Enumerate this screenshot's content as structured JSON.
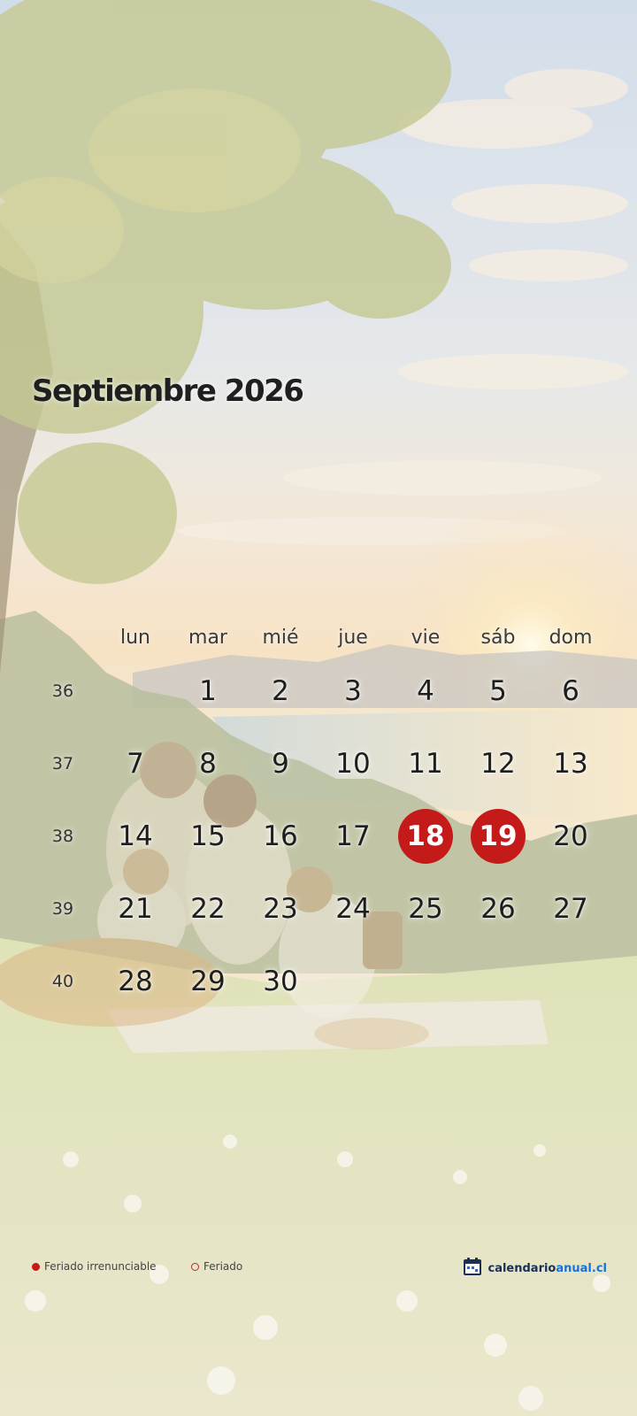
{
  "calendar": {
    "title": "Septiembre 2026",
    "weekdays": [
      "lun",
      "mar",
      "mié",
      "jue",
      "vie",
      "sáb",
      "dom"
    ],
    "weeks": [
      {
        "number": "36",
        "days": [
          "",
          "1",
          "2",
          "3",
          "4",
          "5",
          "6"
        ]
      },
      {
        "number": "37",
        "days": [
          "7",
          "8",
          "9",
          "10",
          "11",
          "12",
          "13"
        ]
      },
      {
        "number": "38",
        "days": [
          "14",
          "15",
          "16",
          "17",
          "18",
          "19",
          "20"
        ]
      },
      {
        "number": "39",
        "days": [
          "21",
          "22",
          "23",
          "24",
          "25",
          "26",
          "27"
        ]
      },
      {
        "number": "40",
        "days": [
          "28",
          "29",
          "30",
          "",
          "",
          "",
          ""
        ]
      }
    ],
    "holidays_irrenunciable": [
      "18",
      "19"
    ]
  },
  "legend": {
    "irrenunciable_label": "Feriado irrenunciable",
    "feriado_label": "Feriado"
  },
  "brand": {
    "name_part1": "calendario",
    "name_part2": "anual.cl"
  },
  "colors": {
    "holiday_red": "#c41a1a",
    "brand_dark": "#1b2f55",
    "brand_blue": "#1a72d6"
  }
}
